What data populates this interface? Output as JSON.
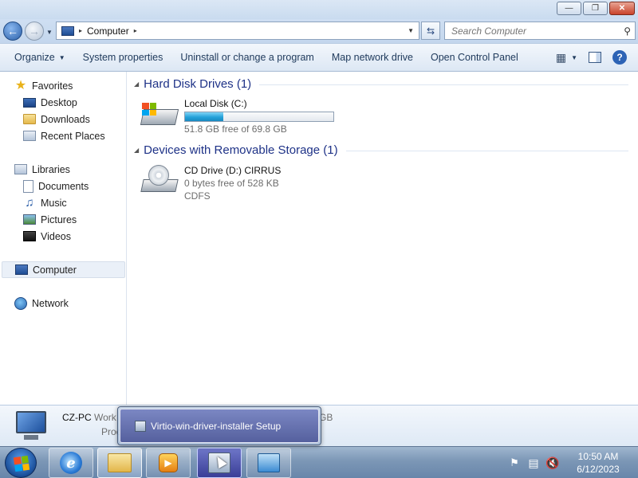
{
  "window": {
    "controls": {
      "minimize": "—",
      "maximize": "❐",
      "close": "✕"
    }
  },
  "nav": {
    "back_icon": "back-arrow-icon",
    "forward_icon": "forward-arrow-icon",
    "address": {
      "path": "Computer",
      "separator": "▸"
    },
    "search_placeholder": "Search Computer"
  },
  "toolbar": {
    "organize": "Organize",
    "system_properties": "System properties",
    "uninstall": "Uninstall or change a program",
    "map_drive": "Map network drive",
    "control_panel": "Open Control Panel"
  },
  "sidebar": {
    "favorites": "Favorites",
    "desktop": "Desktop",
    "downloads": "Downloads",
    "recent": "Recent Places",
    "libraries": "Libraries",
    "documents": "Documents",
    "music": "Music",
    "pictures": "Pictures",
    "videos": "Videos",
    "computer": "Computer",
    "network": "Network"
  },
  "content": {
    "hdd_group": "Hard Disk Drives (1)",
    "local_disk": {
      "name": "Local Disk (C:)",
      "free": "51.8 GB free of 69.8 GB",
      "used_fraction": 0.258
    },
    "removable_group": "Devices with Removable Storage (1)",
    "cd_drive": {
      "name": "CD Drive (D:) CIRRUS",
      "free": "0 bytes free of 528 KB",
      "fs": "CDFS"
    }
  },
  "details": {
    "name": "CZ-PC",
    "workgroup": "Work",
    "processor": "Proc",
    "memory": "GB"
  },
  "popup": {
    "title": "Virtio-win-driver-installer Setup"
  },
  "taskbar": {
    "clock_time": "10:50 AM",
    "clock_date": "6/12/2023"
  },
  "colors": {
    "accent": "#1e3287",
    "capacity_fill": "#25a2d9",
    "toolbar_text": "#1e395b"
  }
}
